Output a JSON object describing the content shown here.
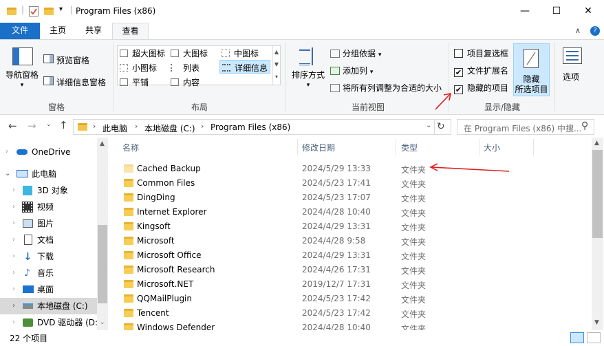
{
  "window": {
    "title": "Program Files (x86)",
    "minimize_glyph": "—",
    "maximize_glyph": "☐",
    "close_glyph": "✕",
    "quick_access_glyph": "▾"
  },
  "ribbon_tabs": [
    "文件",
    "主页",
    "共享",
    "查看"
  ],
  "ribbon": {
    "panes": {
      "group_label": "窗格",
      "nav_pane": "导航窗格",
      "preview_pane": "预览窗格",
      "details_pane": "详细信息窗格"
    },
    "layout": {
      "group_label": "布局",
      "options": [
        "超大图标",
        "大图标",
        "中图标",
        "小图标",
        "列表",
        "详细信息",
        "平铺",
        "内容"
      ]
    },
    "current_view": {
      "group_label": "当前视图",
      "sort_by": "排序方式",
      "group_by": "分组依据",
      "add_columns": "添加列",
      "size_all_columns": "将所有列调整为合适的大小"
    },
    "show_hide": {
      "group_label": "显示/隐藏",
      "item_checkboxes": "项目复选框",
      "item_checkboxes_checked": false,
      "file_extensions": "文件扩展名",
      "file_extensions_checked": true,
      "hidden_items": "隐藏的项目",
      "hidden_items_checked": true,
      "hide_selected_line1": "隐藏",
      "hide_selected_line2": "所选项目"
    },
    "options": "选项",
    "collapse_glyph": "∧",
    "help_glyph": "?"
  },
  "address": {
    "segments": [
      "此电脑",
      "本地磁盘 (C:)",
      "Program Files (x86)"
    ],
    "search_placeholder": "在 Program Files (x86) 中搜..."
  },
  "nav_pane": {
    "items": [
      "OneDrive",
      "此电脑",
      "3D 对象",
      "视频",
      "图片",
      "文档",
      "下载",
      "音乐",
      "桌面",
      "本地磁盘 (C:)",
      "DVD 驱动器 (D:"
    ]
  },
  "columns": {
    "name": "名称",
    "date": "修改日期",
    "type": "类型",
    "size": "大小"
  },
  "files": [
    {
      "name": "Cached Backup",
      "date": "2024/5/29 13:33",
      "type": "文件夹"
    },
    {
      "name": "Common Files",
      "date": "2024/5/23 17:41",
      "type": "文件夹"
    },
    {
      "name": "DingDing",
      "date": "2024/5/23 17:07",
      "type": "文件夹"
    },
    {
      "name": "Internet Explorer",
      "date": "2024/4/28 10:40",
      "type": "文件夹"
    },
    {
      "name": "Kingsoft",
      "date": "2024/4/29 13:31",
      "type": "文件夹"
    },
    {
      "name": "Microsoft",
      "date": "2024/4/28 9:58",
      "type": "文件夹"
    },
    {
      "name": "Microsoft Office",
      "date": "2024/4/29 13:31",
      "type": "文件夹"
    },
    {
      "name": "Microsoft Research",
      "date": "2024/4/26 17:31",
      "type": "文件夹"
    },
    {
      "name": "Microsoft.NET",
      "date": "2019/12/7 17:31",
      "type": "文件夹"
    },
    {
      "name": "QQMailPlugin",
      "date": "2024/5/23 17:42",
      "type": "文件夹"
    },
    {
      "name": "Tencent",
      "date": "2024/5/23 17:42",
      "type": "文件夹"
    },
    {
      "name": "Windows Defender",
      "date": "2024/4/28 10:40",
      "type": "文件夹"
    }
  ],
  "status": {
    "item_count": "22 个项目"
  },
  "colors": {
    "accent": "#1a6fc9",
    "selected_bg": "#cce8ff",
    "annotation_arrow": "#e02020"
  }
}
